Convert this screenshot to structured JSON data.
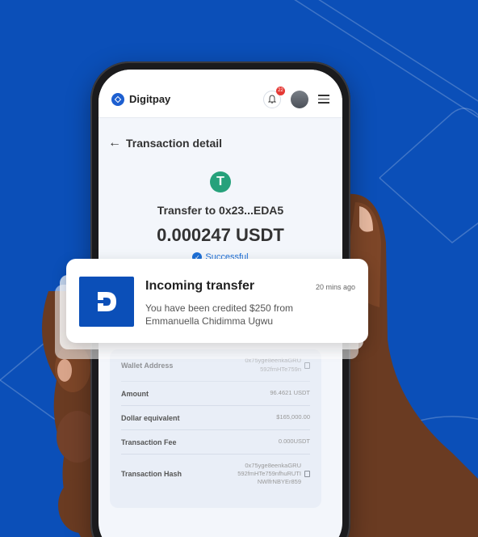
{
  "brand": {
    "name": "Digitpay"
  },
  "header": {
    "notification_count": "22"
  },
  "page": {
    "back_title": "Transaction detail"
  },
  "transaction": {
    "to": "Transfer to 0x23...EDA5",
    "amount": "0.000247 USDT",
    "status": "Successful",
    "token_symbol": "T"
  },
  "details": [
    {
      "label": "Wallet Address",
      "value_lines": [
        "0x75yge8eenkaGRU",
        "592fmHTe759n"
      ],
      "copyable": true
    },
    {
      "label": "Amount",
      "value_lines": [
        "96.4621 USDT"
      ],
      "copyable": false
    },
    {
      "label": "Dollar equivalent",
      "value_lines": [
        "$165,000.00"
      ],
      "copyable": false
    },
    {
      "label": "Transaction Fee",
      "value_lines": [
        "0.000USDT"
      ],
      "copyable": false
    },
    {
      "label": "Transaction Hash",
      "value_lines": [
        "0x75yge8eenkaGRU",
        "592fmHTe759nfhuRUTI",
        "NWlfrNBYEr859"
      ],
      "copyable": true
    }
  ],
  "notification": {
    "title": "Incoming transfer",
    "time": "20 mins ago",
    "message": "You have been credited $250 from Emmanuella Chidimma Ugwu"
  },
  "colors": {
    "background": "#0b4fb8",
    "accent": "#1d6fd6",
    "tether": "#26a17b"
  },
  "icons": {
    "share": "share-icon",
    "star": "star-icon",
    "warning": "warning-icon"
  }
}
